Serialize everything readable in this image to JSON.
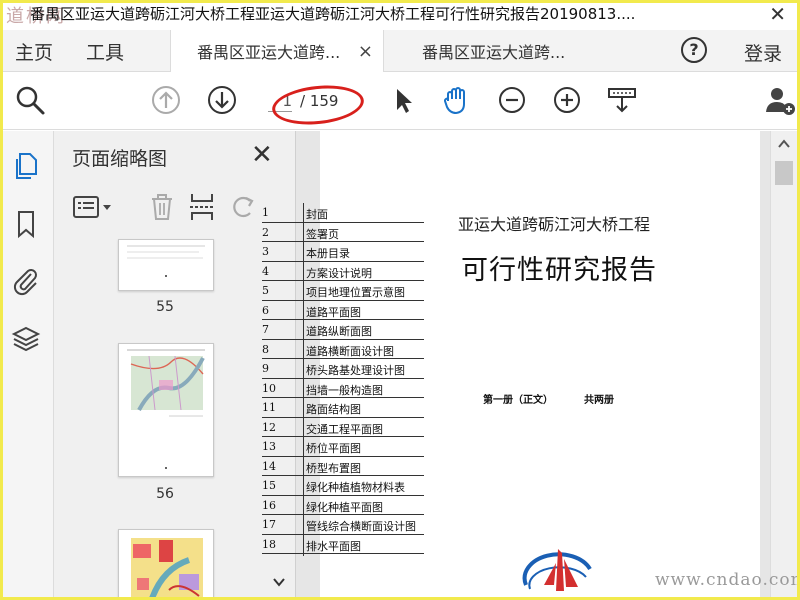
{
  "window": {
    "title": "番禺区亚运大道跨砺江河大桥工程亚运大道跨砺江河大桥工程可行性研究报告20190813....",
    "watermark": "道桥网",
    "close_glyph": "✕"
  },
  "nav": {
    "home": "主页",
    "tools": "工具",
    "login": "登录",
    "help_glyph": "?"
  },
  "tabs": [
    {
      "label": "番禺区亚运大道跨...",
      "close": "×"
    },
    {
      "label": "番禺区亚运大道跨..."
    }
  ],
  "toolbar": {
    "page_current": "1",
    "page_total": "/ 159"
  },
  "thumbnails": {
    "title": "页面缩略图",
    "close": "✕",
    "pages": [
      {
        "number": "55"
      },
      {
        "number": "56"
      }
    ]
  },
  "document": {
    "toc": [
      {
        "num": "1",
        "title": "封面"
      },
      {
        "num": "2",
        "title": "签署页"
      },
      {
        "num": "3",
        "title": "本册目录"
      },
      {
        "num": "4",
        "title": "方案设计说明"
      },
      {
        "num": "5",
        "title": "项目地理位置示意图"
      },
      {
        "num": "6",
        "title": "道路平面图"
      },
      {
        "num": "7",
        "title": "道路纵断面图"
      },
      {
        "num": "8",
        "title": "道路横断面设计图"
      },
      {
        "num": "9",
        "title": "桥头路基处理设计图"
      },
      {
        "num": "10",
        "title": "挡墙一般构造图"
      },
      {
        "num": "11",
        "title": "路面结构图"
      },
      {
        "num": "12",
        "title": "交通工程平面图"
      },
      {
        "num": "13",
        "title": "桥位平面图"
      },
      {
        "num": "14",
        "title": "桥型布置图"
      },
      {
        "num": "15",
        "title": "绿化种植植物材料表"
      },
      {
        "num": "16",
        "title": "绿化种植平面图"
      },
      {
        "num": "17",
        "title": "管线综合横断面设计图"
      },
      {
        "num": "18",
        "title": "排水平面图"
      }
    ],
    "project_name": "亚运大道跨砺江河大桥工程",
    "report_title": "可行性研究报告",
    "volume": "第一册（正文）",
    "volume_count": "共两册"
  },
  "site_watermark": "www.cndao.com",
  "colors": {
    "accent_blue": "#1a73c9",
    "annotation_red": "#d8201c",
    "frame_yellow": "#f2ea4d"
  }
}
